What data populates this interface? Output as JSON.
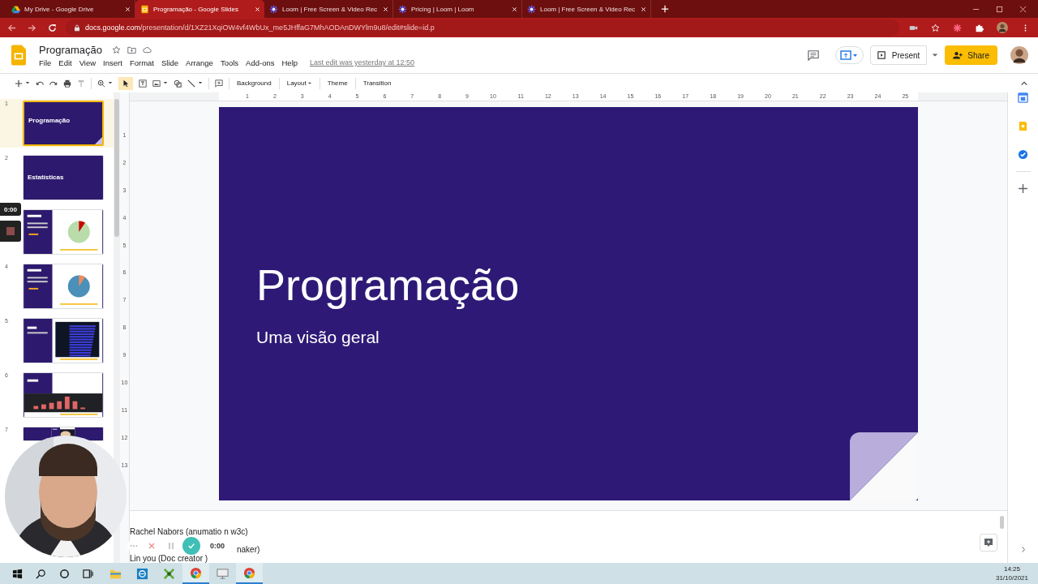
{
  "browser": {
    "tabs": [
      {
        "title": "My Drive - Google Drive",
        "selected": false
      },
      {
        "title": "Programação - Google Slides",
        "selected": true
      },
      {
        "title": "Loom | Free Screen & Video Rec",
        "selected": false
      },
      {
        "title": "Pricing | Loom | Loom",
        "selected": false
      },
      {
        "title": "Loom | Free Screen & Video Rec",
        "selected": false
      }
    ],
    "url_host": "docs.google.com",
    "url_path": "/presentation/d/1XZ21XqiOW4vf4WbUx_me5JHffaG7MhAODAnDWYlm9u8/edit#slide=id.p"
  },
  "doc": {
    "title": "Programação",
    "menu": [
      "File",
      "Edit",
      "View",
      "Insert",
      "Format",
      "Slide",
      "Arrange",
      "Tools",
      "Add-ons",
      "Help"
    ],
    "last_edit": "Last edit was yesterday at 12:50",
    "present_label": "Present",
    "share_label": "Share"
  },
  "toolbar": {
    "buttons": [
      {
        "label": "Background",
        "dropdown": false
      },
      {
        "label": "Layout",
        "dropdown": true
      },
      {
        "label": "Theme",
        "dropdown": false
      },
      {
        "label": "Transition",
        "dropdown": false
      }
    ]
  },
  "ruler": {
    "horizontal": [
      "1",
      "2",
      "3",
      "4",
      "5",
      "6",
      "7",
      "8",
      "9",
      "10",
      "11",
      "12",
      "13",
      "14",
      "15",
      "16",
      "17",
      "18",
      "19",
      "20",
      "21",
      "22",
      "23",
      "24",
      "25"
    ],
    "vertical": [
      "1",
      "2",
      "3",
      "4",
      "5",
      "6",
      "7",
      "8",
      "9",
      "10",
      "11",
      "12",
      "13"
    ]
  },
  "slides": [
    {
      "number": "1",
      "selected": true,
      "kind": "title",
      "title": "Programação"
    },
    {
      "number": "2",
      "selected": false,
      "kind": "section",
      "title": "Estatísticas"
    },
    {
      "selected": false,
      "kind": "pie"
    },
    {
      "number": "4",
      "selected": false,
      "kind": "pie"
    },
    {
      "number": "5",
      "selected": false,
      "kind": "hbars"
    },
    {
      "number": "6",
      "selected": false,
      "kind": "bars"
    },
    {
      "number": "7",
      "selected": false
    }
  ],
  "current_slide": {
    "title": "Programação",
    "subtitle": "Uma visão geral"
  },
  "notes": {
    "lines": [
      "Rachel Nabors (anumatio n w3c)",
      "Lin you (Doc creator )"
    ],
    "fragment": "naker)"
  },
  "recorder": {
    "timer": "0:00",
    "controls_timer": "0:00"
  },
  "taskbar": {
    "apps": [
      {
        "kind": "explorer",
        "running": false
      },
      {
        "kind": "app",
        "running": false
      },
      {
        "kind": "xmind",
        "running": false
      },
      {
        "kind": "chrome",
        "running": true
      },
      {
        "kind": "monitor",
        "running": false
      },
      {
        "kind": "chrome",
        "running": true
      }
    ],
    "time": "14:25",
    "date": "31/10/2021"
  }
}
